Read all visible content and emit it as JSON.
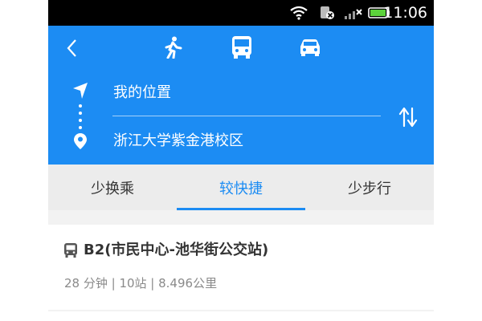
{
  "status_bar": {
    "time": "11:06",
    "icons": [
      "wifi-icon",
      "sim-icon",
      "signal-icon",
      "battery-icon"
    ]
  },
  "header": {
    "back_icon": "chevron-left-icon",
    "modes": [
      {
        "name": "walk",
        "icon": "walk-icon"
      },
      {
        "name": "bus",
        "icon": "bus-icon"
      },
      {
        "name": "car",
        "icon": "car-icon"
      }
    ],
    "origin": "我的位置",
    "destination": "浙江大学紫金港校区",
    "swap_icon": "swap-icon",
    "accent_color": "#1c8cf3"
  },
  "tabs": [
    {
      "label": "少换乘",
      "active": false
    },
    {
      "label": "较快捷",
      "active": true
    },
    {
      "label": "少步行",
      "active": false
    }
  ],
  "routes": [
    {
      "title": "B2(市民中心-池华街公交站)",
      "meta": "28 分钟 | 10站 | 8.496公里",
      "icon": "bus-icon"
    }
  ]
}
